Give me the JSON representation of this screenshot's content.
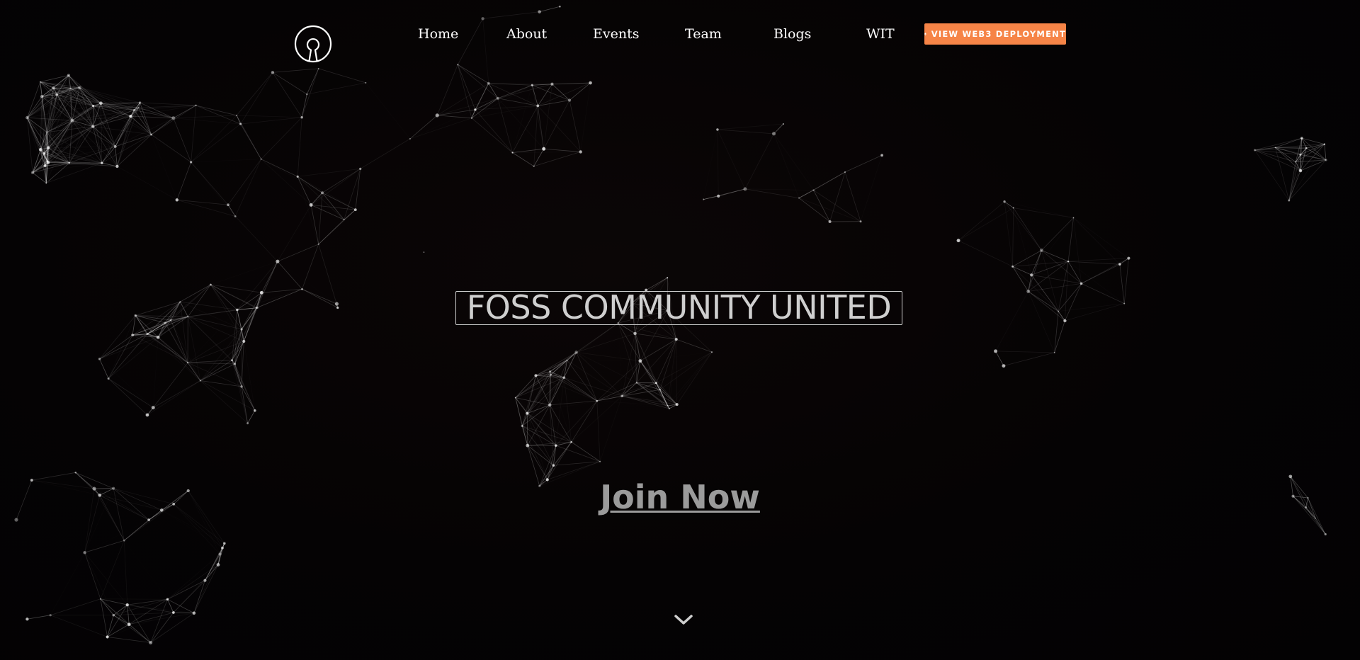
{
  "nav": {
    "items": [
      {
        "label": "Home"
      },
      {
        "label": "About"
      },
      {
        "label": "Events"
      },
      {
        "label": "Team"
      },
      {
        "label": "Blogs"
      },
      {
        "label": "WIT"
      }
    ],
    "cta_label": "VIEW WEB3 DEPLOYMENT",
    "cta_icon": "ethereum-icon"
  },
  "logo": {
    "icon": "open-source-logo-icon"
  },
  "hero": {
    "title": "FOSS COMMUNITY UNITED",
    "join_label": "Join Now",
    "scroll_icon": "chevron-down-icon"
  },
  "colors": {
    "background": "#050304",
    "accent": "#f68447",
    "text": "#ffffff",
    "title": "#cfcfcf",
    "join": "#9b9b9b"
  }
}
